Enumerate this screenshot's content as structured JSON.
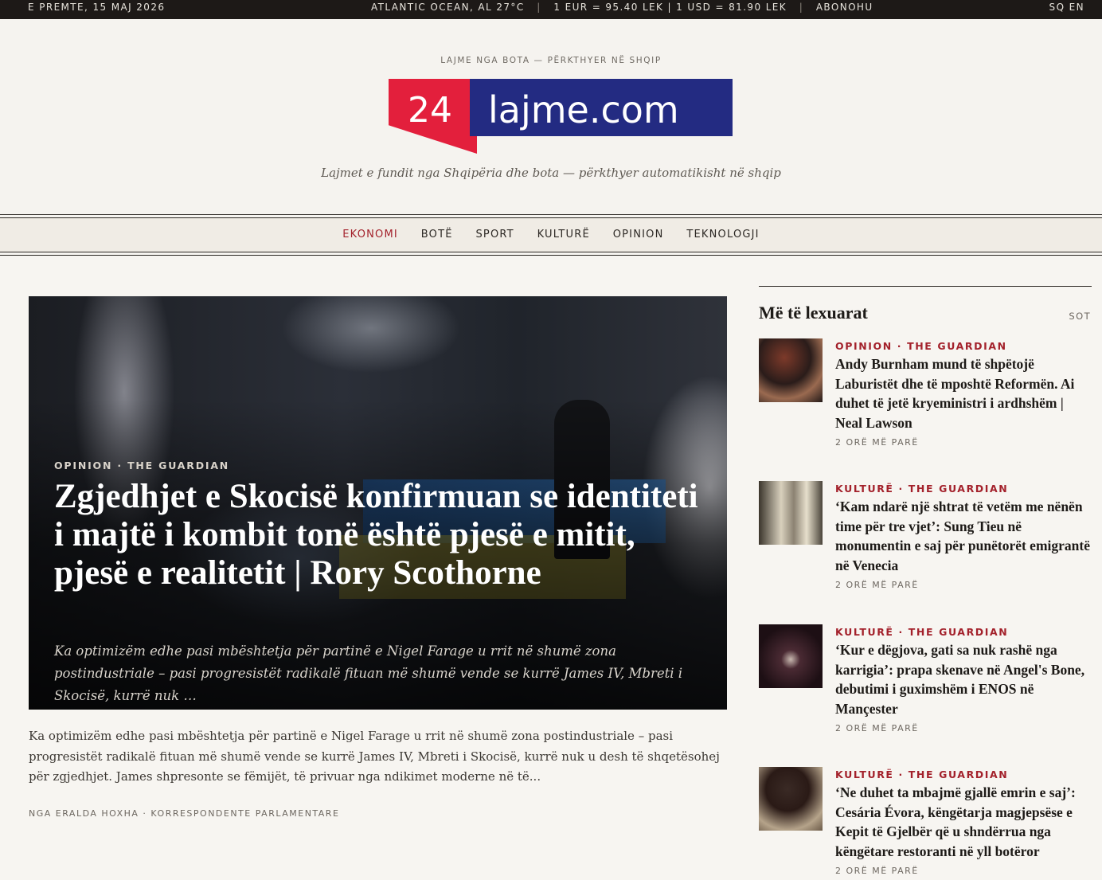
{
  "topbar": {
    "date": "E PREMTE, 15 MAJ 2026",
    "weather": "ATLANTIC OCEAN, AL 27°C",
    "rates": "1 EUR = 95.40 LEK | 1 USD = 81.90 LEK",
    "subscribe": "ABONOHU",
    "lang_sq": "SQ",
    "lang_en": "EN"
  },
  "masthead": {
    "kicker": "LAJME NGA BOTA — PËRKTHYER NË SHQIP",
    "logo_num": "24",
    "logo_word": "lajme.com",
    "tagline": "Lajmet e fundit nga Shqipëria dhe bota — përkthyer automatikisht në shqip",
    "colors": {
      "logo_red": "#e31f3c",
      "logo_blue": "#232b82",
      "accent": "#a3212b"
    }
  },
  "nav": {
    "items": [
      "EKONOMI",
      "BOTË",
      "SPORT",
      "KULTURË",
      "OPINION",
      "TEKNOLOGJI"
    ],
    "active": "EKONOMI"
  },
  "hero": {
    "category": "OPINION · THE GUARDIAN",
    "title": "Zgjedhjet e Skocisë konfirmuan se identiteti i majtë i kombit tonë është pjesë e mitit, pjesë e realitetit | Rory Scothorne",
    "dek": "Ka optimizëm edhe pasi mbështetja për partinë e Nigel Farage u rrit në shumë zona postindustriale – pasi progresistët radikalë fituan më shumë vende se kurrë James IV, Mbreti i Skocisë, kurrë nuk …",
    "lede": "Ka optimizëm edhe pasi mbështetja për partinë e Nigel Farage u rrit në shumë zona postindustriale – pasi progresistët radikalë fituan më shumë vende se kurrë James IV, Mbreti i Skocisë, kurrë nuk u desh të shqetësohej për zgjedhjet. James shpresonte se fëmijët, të privuar nga ndikimet moderne në të...",
    "byline": "NGA ERALDA HOXHA · KORRESPONDENTE PARLAMENTARE"
  },
  "sidebar": {
    "title": "Më të lexuarat",
    "period": "SOT",
    "items": [
      {
        "category": "OPINION · THE GUARDIAN",
        "headline": "Andy Burnham mund të shpëtojë Laburistët dhe të mposhtë Reformën. Ai duhet të jetë kryeministri i ardhshëm | Neal Lawson",
        "time": "2 ORË MË PARË"
      },
      {
        "category": "KULTURË · THE GUARDIAN",
        "headline": "‘Kam ndarë një shtrat të vetëm me nënën time për tre vjet’: Sung Tieu në monumentin e saj për punëtorët emigrantë në Venecia",
        "time": "2 ORË MË PARË"
      },
      {
        "category": "KULTURË · THE GUARDIAN",
        "headline": "‘Kur e dëgjova, gati sa nuk rashë nga karrigia’: prapa skenave në Angel's Bone, debutimi i guximshëm i ENOS në Mançester",
        "time": "2 ORË MË PARË"
      },
      {
        "category": "KULTURË · THE GUARDIAN",
        "headline": "‘Ne duhet ta mbajmë gjallë emrin e saj’: Cesária Évora, këngëtarja magjepsëse e Kepit të Gjelbër që u shndërrua nga këngëtare restoranti në yll botëror",
        "time": "2 ORË MË PARË"
      }
    ]
  }
}
